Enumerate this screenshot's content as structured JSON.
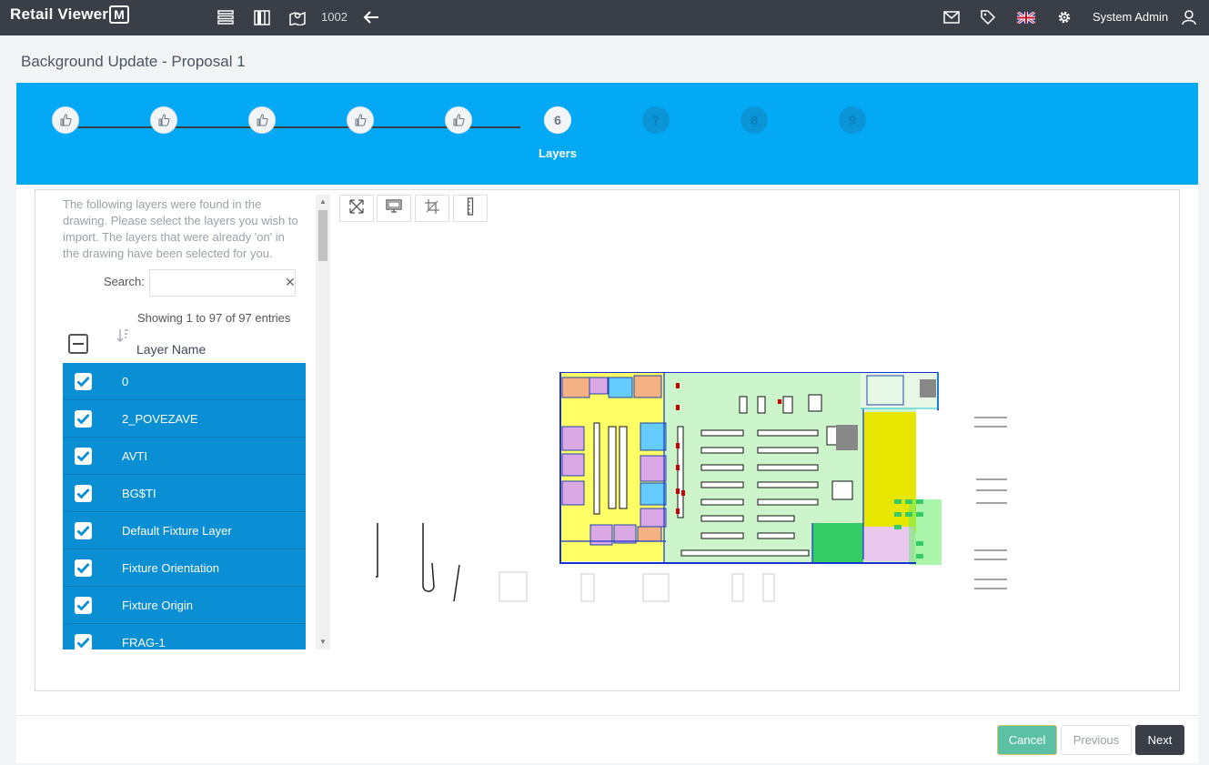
{
  "header": {
    "logo_text": "Retail Viewer",
    "logo_mark": "M",
    "store_number": "1002",
    "user_name": "System Admin",
    "icons": [
      "list-icon",
      "columns-icon",
      "map-icon",
      "back-arrow-icon",
      "mail-icon",
      "tag-icon",
      "uk-flag-icon",
      "gear-icon",
      "user-icon"
    ]
  },
  "page": {
    "title": "Background Update - Proposal 1"
  },
  "wizard": {
    "steps": [
      {
        "label": "",
        "state": "done"
      },
      {
        "label": "",
        "state": "done"
      },
      {
        "label": "",
        "state": "done"
      },
      {
        "label": "",
        "state": "done"
      },
      {
        "label": "",
        "state": "done"
      },
      {
        "label": "6",
        "state": "active"
      },
      {
        "label": "7",
        "state": "todo"
      },
      {
        "label": "8",
        "state": "todo"
      },
      {
        "label": "9",
        "state": "todo"
      }
    ],
    "active_label": "Layers",
    "colors": {
      "bar": "#03a9f4"
    }
  },
  "layers_panel": {
    "intro": "The following layers were found in the drawing. Please select the layers you wish to import. The layers that were already 'on' in the drawing have been selected for you.",
    "search_label": "Search:",
    "search_value": "",
    "entries_info": "Showing 1 to 97 of 97 entries",
    "column_header": "Layer Name",
    "rows": [
      {
        "name": "0",
        "checked": true
      },
      {
        "name": "2_POVEZAVE",
        "checked": true
      },
      {
        "name": "AVTI",
        "checked": true
      },
      {
        "name": "BG$TI",
        "checked": true
      },
      {
        "name": "Default Fixture Layer",
        "checked": true
      },
      {
        "name": "Fixture Orientation",
        "checked": true
      },
      {
        "name": "Fixture Origin",
        "checked": true
      },
      {
        "name": "FRAG-1",
        "checked": true
      }
    ]
  },
  "viewer_tools": [
    "fit-extents-icon",
    "display-icon",
    "crop-icon",
    "ruler-icon"
  ],
  "footer": {
    "cancel_label": "Cancel",
    "previous_label": "Previous",
    "next_label": "Next"
  }
}
